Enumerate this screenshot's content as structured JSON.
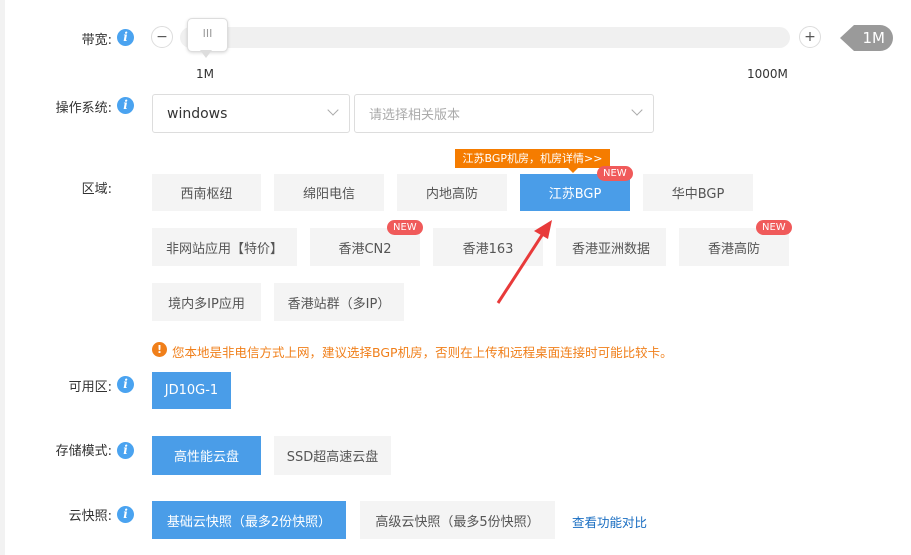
{
  "bandwidth": {
    "label": "带宽:",
    "min_label": "1M",
    "max_label": "1000M",
    "value": "1M",
    "value_mb": 1,
    "min": 1,
    "max": 1000,
    "handle_glyph": "III"
  },
  "os": {
    "label": "操作系统:",
    "value": "windows",
    "version_placeholder": "请选择相关版本"
  },
  "region": {
    "label": "区域:",
    "tooltip": "江苏BGP机房，机房详情>>",
    "new_badge": "NEW",
    "options": [
      "西南枢纽",
      "绵阳电信",
      "内地高防",
      "江苏BGP",
      "华中BGP",
      "非网站应用【特价】",
      "香港CN2",
      "香港163",
      "香港亚洲数据",
      "香港高防",
      "境内多IP应用",
      "香港站群（多IP）"
    ],
    "selected": "江苏BGP",
    "warning": "您本地是非电信方式上网，建议选择BGP机房，否则在上传和远程桌面连接时可能比较卡。"
  },
  "zone": {
    "label": "可用区:",
    "options": [
      "JD10G-1"
    ]
  },
  "storage": {
    "label": "存储模式:",
    "options": [
      "高性能云盘",
      "SSD超高速云盘"
    ]
  },
  "snapshot": {
    "label": "云快照:",
    "options": [
      "基础云快照（最多2份快照）",
      "高级云快照（最多5份快照）"
    ],
    "compare_link": "查看功能对比"
  },
  "colors": {
    "accent": "#4a9de8",
    "warning": "#f07f1a",
    "badge": "#f05a5a",
    "tooltip": "#f57c00"
  }
}
